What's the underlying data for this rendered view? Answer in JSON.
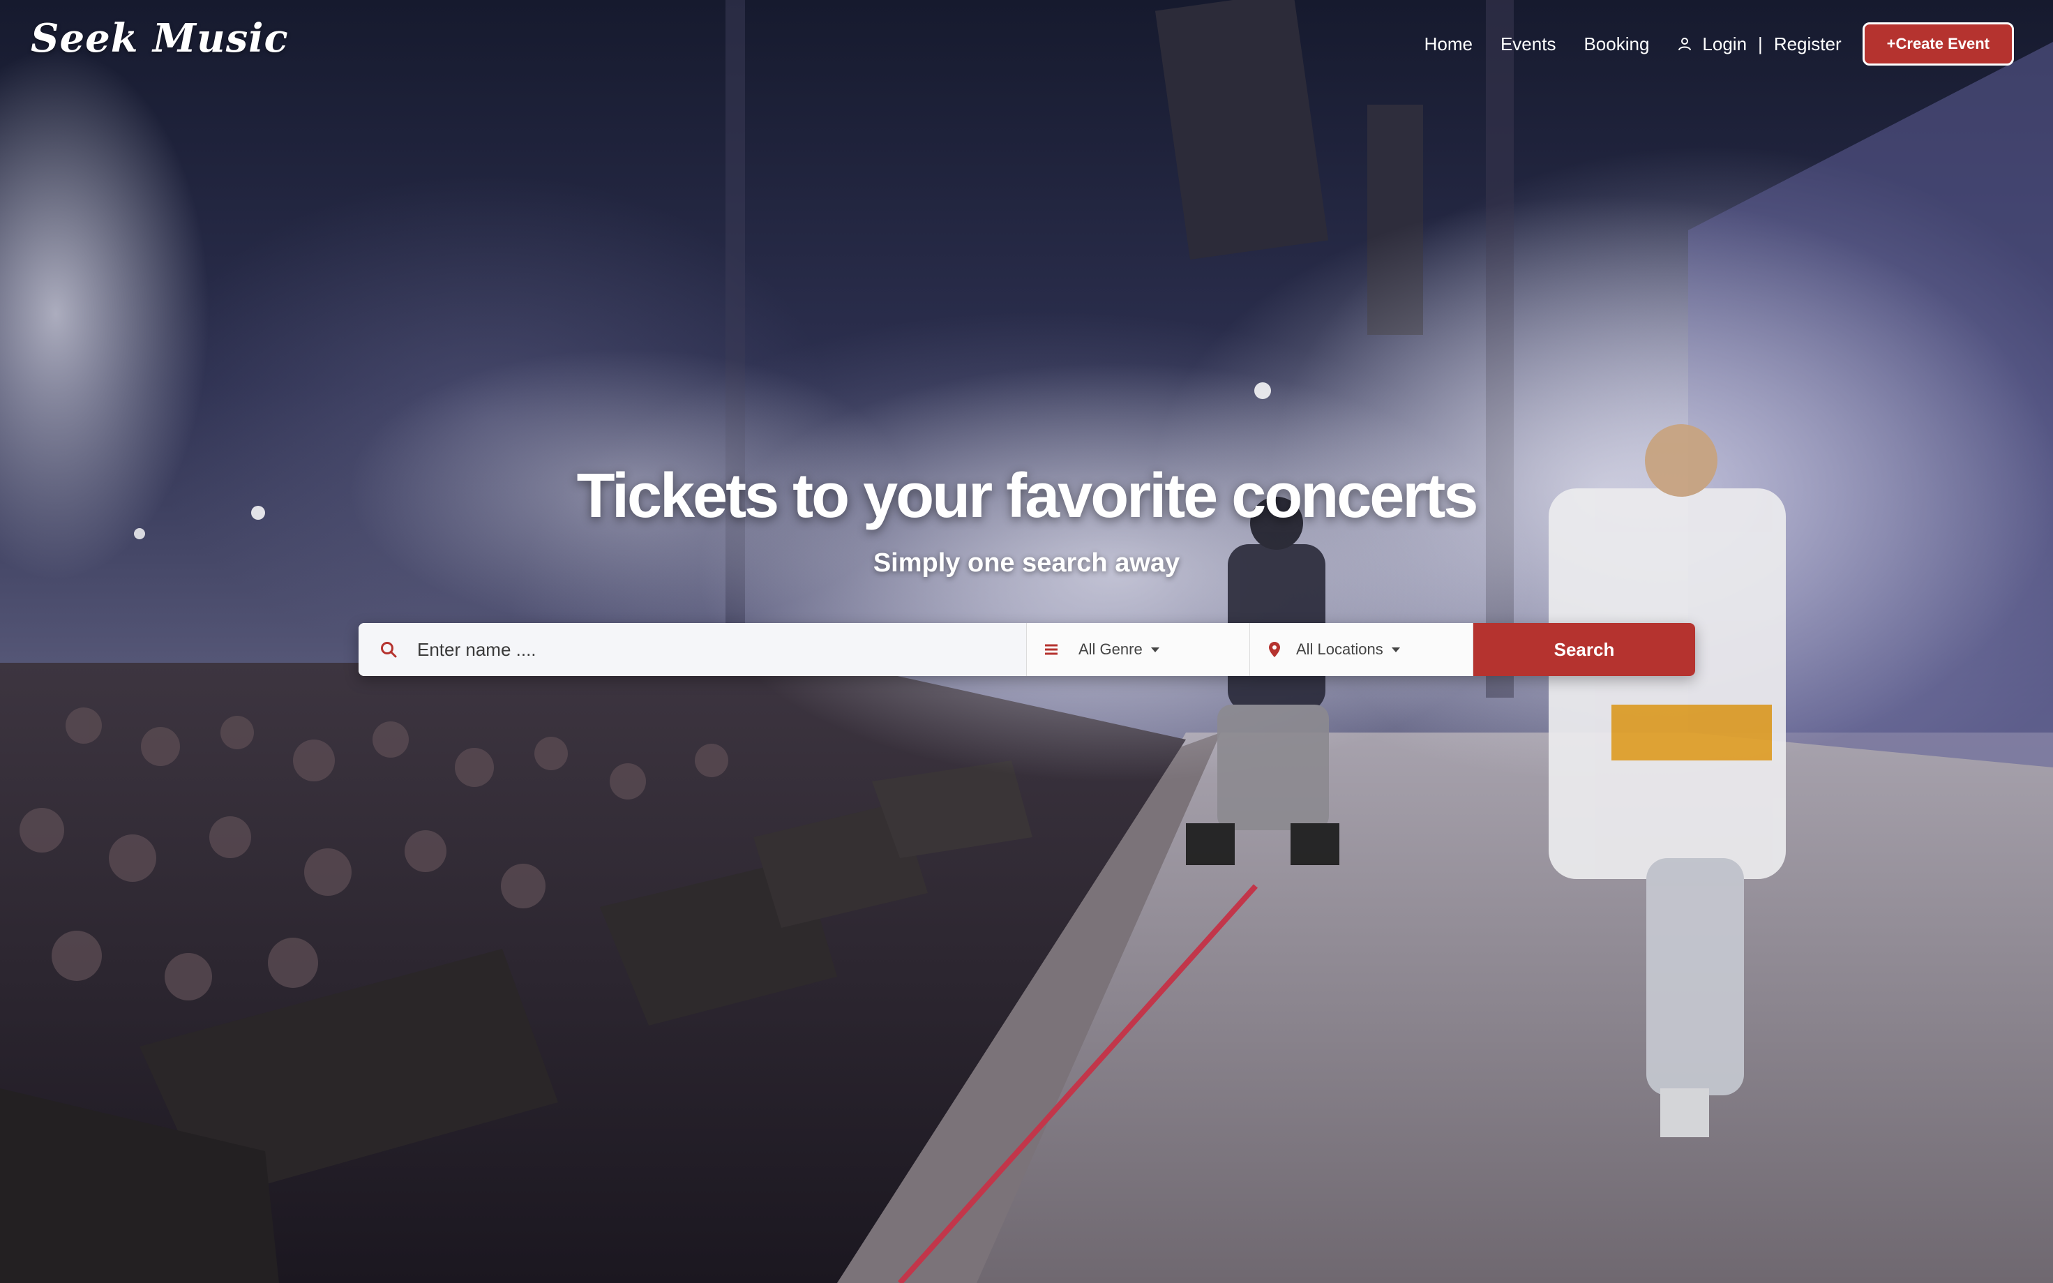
{
  "brand": {
    "logo_text": "Seek Music"
  },
  "nav": {
    "links": [
      "Home",
      "Events",
      "Booking"
    ],
    "login_label": "Login",
    "separator": "|",
    "register_label": "Register",
    "create_event_label": "+Create Event"
  },
  "hero": {
    "title": "Tickets to your favorite concerts",
    "subtitle": "Simply one search away"
  },
  "search": {
    "name_placeholder": "Enter name ....",
    "genre_selected": "All Genre",
    "location_selected": "All Locations",
    "button_label": "Search"
  },
  "colors": {
    "accent": "#b5332f",
    "text_light": "#ffffff",
    "search_bg": "#f5f6f9"
  },
  "icons": {
    "user": "user-icon",
    "search": "search-icon",
    "genre": "list-icon",
    "location": "map-pin-icon",
    "dropdown": "caret-down-icon"
  }
}
